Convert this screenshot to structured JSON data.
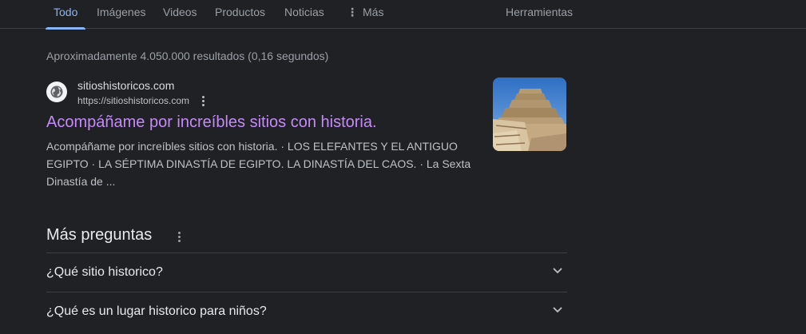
{
  "tabs": [
    {
      "label": "Todo",
      "active": true
    },
    {
      "label": "Imágenes",
      "active": false
    },
    {
      "label": "Videos",
      "active": false
    },
    {
      "label": "Productos",
      "active": false
    },
    {
      "label": "Noticias",
      "active": false
    },
    {
      "label": "Más",
      "active": false
    }
  ],
  "tools_label": "Herramientas",
  "result_stats": "Aproximadamente 4.050.000 resultados (0,16 segundos)",
  "result": {
    "site_name": "sitioshistoricos.com",
    "url": "https://sitioshistoricos.com",
    "title": "Acompáñame por increíbles sitios con historia.",
    "snippet": "Acompáñame por increíbles sitios con historia. · LOS ELEFANTES Y EL ANTIGUO EGIPTO · LA SÉPTIMA DINASTÍA DE EGIPTO. LA DINASTÍA DEL CAOS. · La Sexta Dinastía de ...",
    "thumbnail_icon": "step-pyramid-image"
  },
  "paa": {
    "title": "Más preguntas",
    "questions": [
      "¿Qué sitio historico?",
      "¿Qué es un lugar historico para niños?"
    ]
  },
  "colors": {
    "background": "#202124",
    "tab_active": "#8ab4f8",
    "visited_link": "#c58af9",
    "text": "#bdc1c6"
  }
}
